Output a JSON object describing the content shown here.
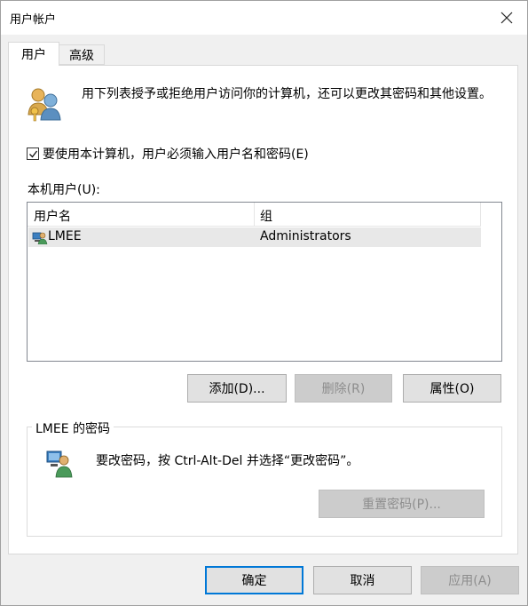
{
  "window": {
    "title": "用户帐户"
  },
  "tabs": [
    {
      "label": "用户"
    },
    {
      "label": "高级"
    }
  ],
  "intro": {
    "text": "用下列表授予或拒绝用户访问你的计算机，还可以更改其密码和其他设置。"
  },
  "require_password": {
    "checked": true,
    "label": "要使用本计算机，用户必须输入用户名和密码(E)"
  },
  "local_users": {
    "label": "本机用户(U):",
    "columns": [
      "用户名",
      "组"
    ],
    "rows": [
      {
        "name": "LMEE",
        "group": "Administrators",
        "selected": true
      }
    ]
  },
  "user_buttons": {
    "add": "添加(D)...",
    "remove": "删除(R)",
    "properties": "属性(O)"
  },
  "password_section": {
    "title": "LMEE 的密码",
    "text": "要改密码，按 Ctrl-Alt-Del 并选择“更改密码”。",
    "reset_button": "重置密码(P)..."
  },
  "dialog_buttons": {
    "ok": "确定",
    "cancel": "取消",
    "apply": "应用(A)"
  },
  "icons": {
    "close": "close-icon",
    "users_group": "users-group-icon",
    "user": "user-icon",
    "password_user": "user-keyboard-icon"
  },
  "colors": {
    "accent": "#0078d7",
    "selection": "#e8e8e8",
    "disabled_text": "#8d8d8d"
  }
}
